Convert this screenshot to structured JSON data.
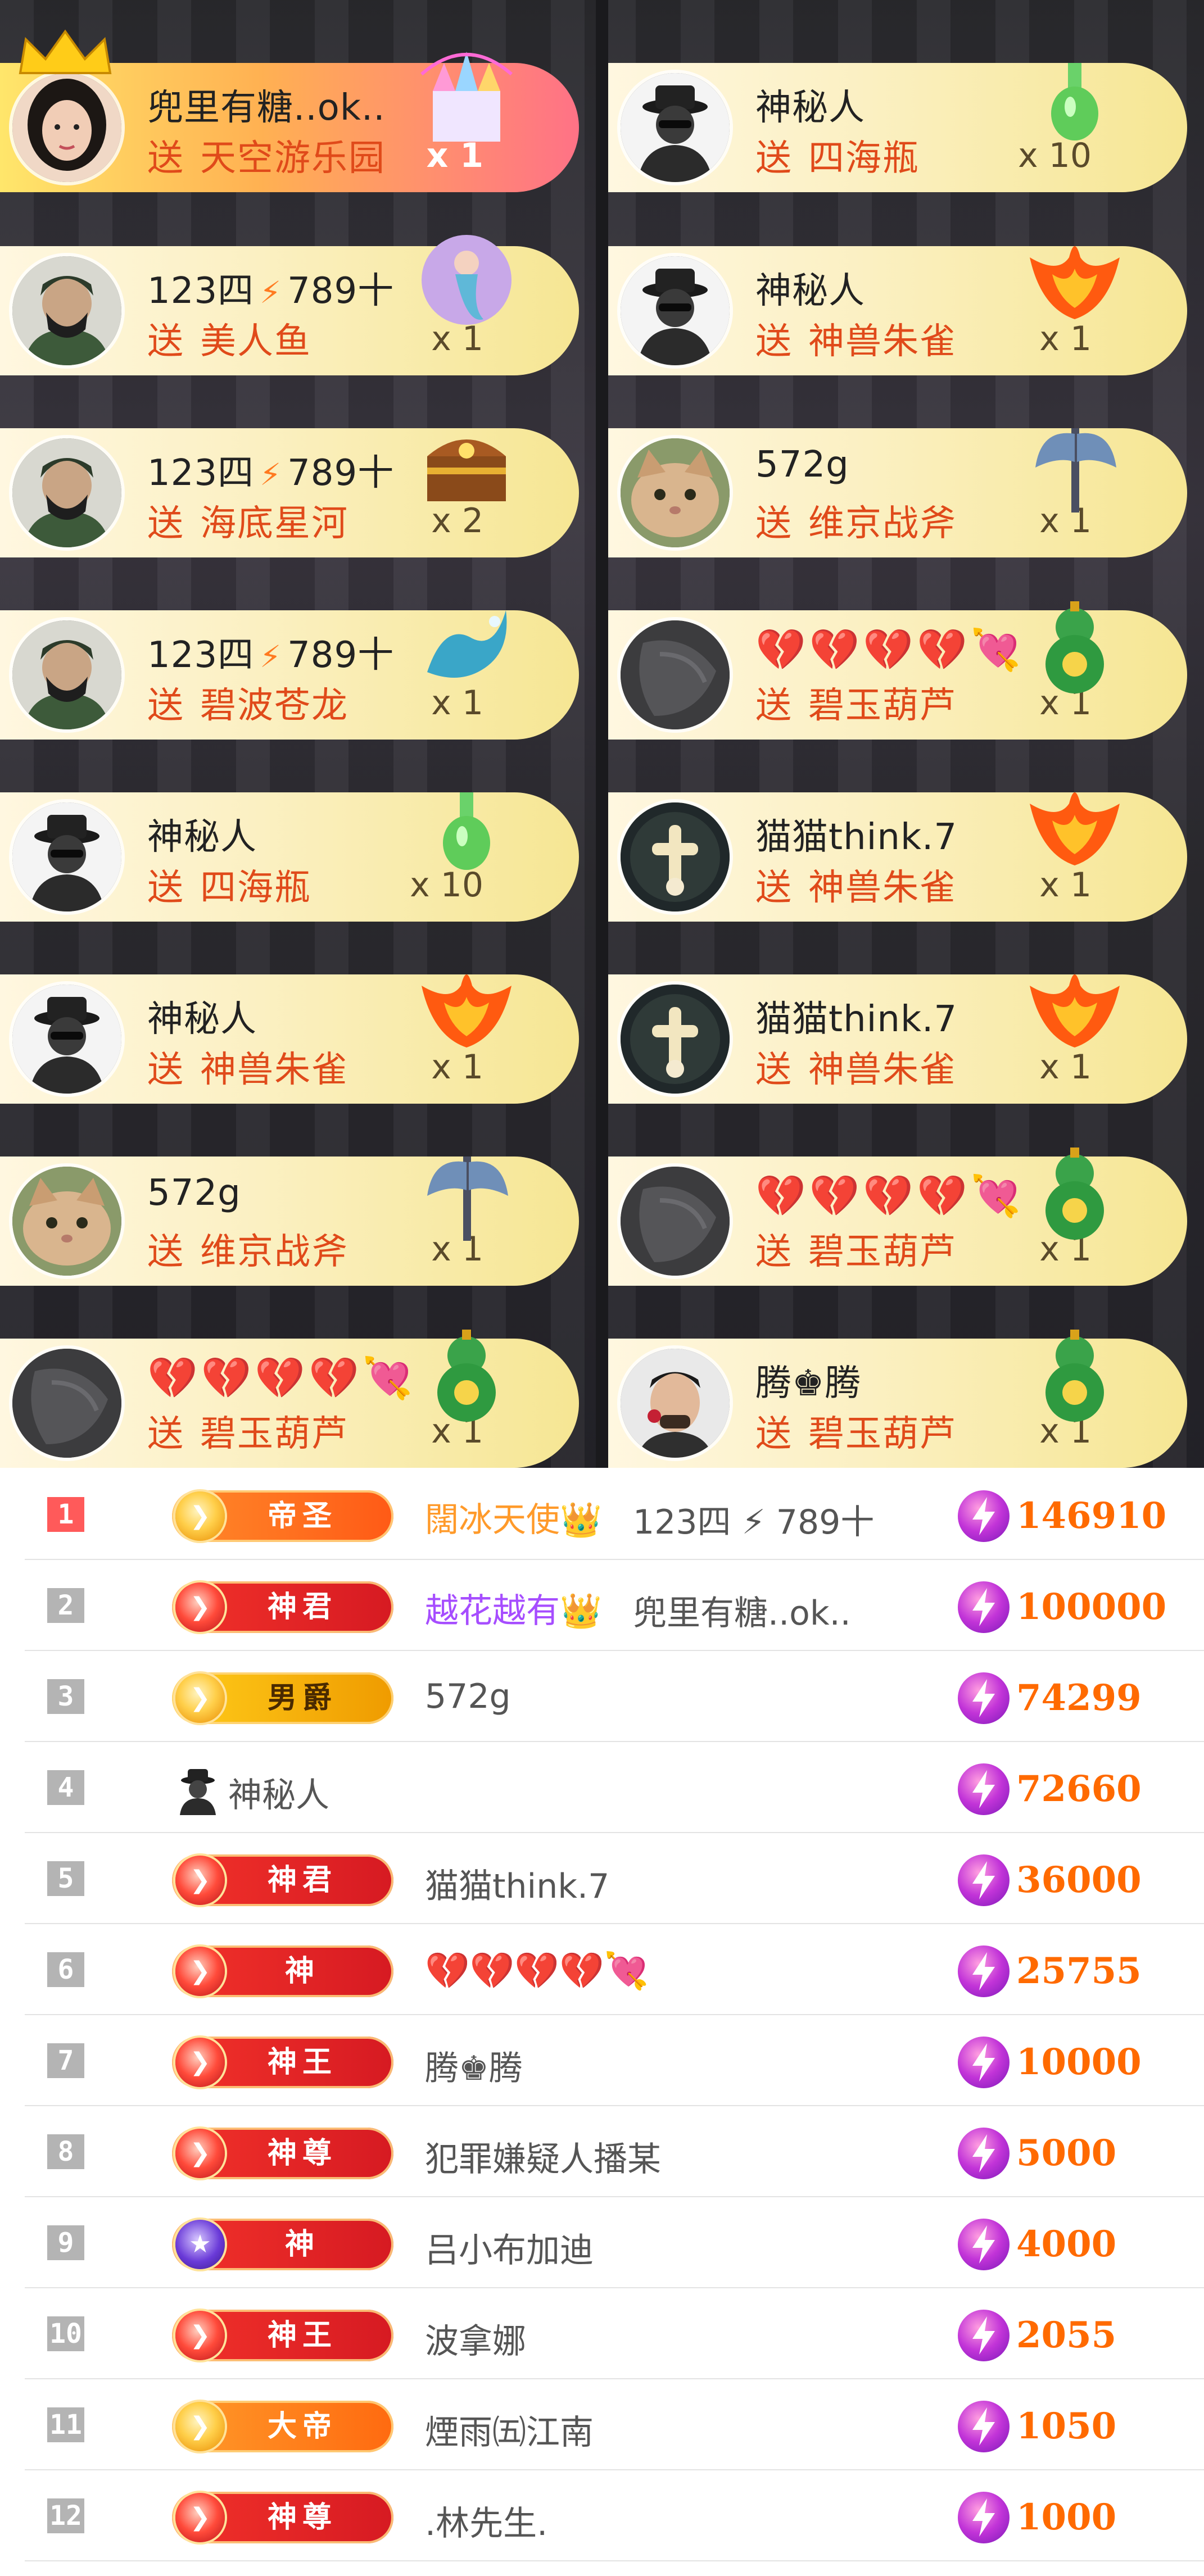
{
  "gift_feed": {
    "left": [
      {
        "user": "兜里有糖..ok..",
        "gift": "天空游乐园",
        "qty": "x 1",
        "send": "送",
        "avatar": "woman-avatar",
        "gift_icon": "castle-gift-icon",
        "vip": true
      },
      {
        "user": "123四",
        "user_suffix": "789十",
        "send": "送",
        "gift": "美人鱼",
        "qty": "x 1",
        "avatar": "warrior-avatar",
        "gift_icon": "mermaid-gift-icon"
      },
      {
        "user": "123四",
        "user_suffix": "789十",
        "send": "送",
        "gift": "海底星河",
        "qty": "x 2",
        "avatar": "warrior-avatar",
        "gift_icon": "treasure-chest-gift-icon"
      },
      {
        "user": "123四",
        "user_suffix": "789十",
        "send": "送",
        "gift": "碧波苍龙",
        "qty": "x 1",
        "avatar": "warrior-avatar",
        "gift_icon": "dragon-gift-icon"
      },
      {
        "user": "神秘人",
        "send": "送",
        "gift": "四海瓶",
        "qty": "x 10",
        "avatar": "mystery-avatar",
        "gift_icon": "bottle-gift-icon"
      },
      {
        "user": "神秘人",
        "send": "送",
        "gift": "神兽朱雀",
        "qty": "x 1",
        "avatar": "mystery-avatar",
        "gift_icon": "phoenix-gift-icon"
      },
      {
        "user": "572g",
        "send": "送",
        "gift": "维京战斧",
        "qty": "x 1",
        "avatar": "cat-avatar",
        "gift_icon": "axe-gift-icon"
      },
      {
        "user_hearts": "💔💔💔💔💘",
        "send": "送",
        "gift": "碧玉葫芦",
        "qty": "x 1",
        "avatar": "dark-avatar",
        "gift_icon": "gourd-gift-icon"
      }
    ],
    "right": [
      {
        "user": "神秘人",
        "send": "送",
        "gift": "四海瓶",
        "qty": "x 10",
        "avatar": "mystery-avatar",
        "gift_icon": "bottle-gift-icon"
      },
      {
        "user": "神秘人",
        "send": "送",
        "gift": "神兽朱雀",
        "qty": "x 1",
        "avatar": "mystery-avatar",
        "gift_icon": "phoenix-gift-icon"
      },
      {
        "user": "572g",
        "send": "送",
        "gift": "维京战斧",
        "qty": "x 1",
        "avatar": "cat-avatar",
        "gift_icon": "axe-gift-icon"
      },
      {
        "user_hearts": "💔💔💔💔💘",
        "send": "送",
        "gift": "碧玉葫芦",
        "qty": "x 1",
        "avatar": "dark-avatar",
        "gift_icon": "gourd-gift-icon"
      },
      {
        "user": "猫猫think.7",
        "send": "送",
        "gift": "神兽朱雀",
        "qty": "x 1",
        "avatar": "cross-avatar",
        "gift_icon": "phoenix-gift-icon"
      },
      {
        "user": "猫猫think.7",
        "send": "送",
        "gift": "神兽朱雀",
        "qty": "x 1",
        "avatar": "cross-avatar",
        "gift_icon": "phoenix-gift-icon"
      },
      {
        "user_hearts": "💔💔💔💔💘",
        "send": "送",
        "gift": "碧玉葫芦",
        "qty": "x 1",
        "avatar": "dark-avatar",
        "gift_icon": "gourd-gift-icon"
      },
      {
        "user": "腾♚腾",
        "send": "送",
        "gift": "碧玉葫芦",
        "qty": "x 1",
        "avatar": "man-rose-avatar",
        "gift_icon": "gourd-gift-icon"
      }
    ]
  },
  "ranking": [
    {
      "rank": "1",
      "badge": "帝圣",
      "medal_prefix": "闊冰天使👑",
      "name": "123四 ⚡ 789十",
      "score": "146910"
    },
    {
      "rank": "2",
      "badge": "神君",
      "medal_prefix": "越花越有👑",
      "name": "兜里有糖..ok..",
      "score": "100000"
    },
    {
      "rank": "3",
      "badge": "男爵",
      "name": "572g",
      "score": "74299"
    },
    {
      "rank": "4",
      "name": "神秘人",
      "score": "72660"
    },
    {
      "rank": "5",
      "badge": "神君",
      "name": "猫猫think.7",
      "score": "36000"
    },
    {
      "rank": "6",
      "badge": "神",
      "name": "💔💔💔💔💘",
      "score": "25755"
    },
    {
      "rank": "7",
      "badge": "神王",
      "name": "腾♚腾",
      "score": "10000"
    },
    {
      "rank": "8",
      "badge": "神尊",
      "name": "犯罪嫌疑人播某",
      "score": "5000"
    },
    {
      "rank": "9",
      "badge": "神",
      "name": "吕小布加迪",
      "score": "4000"
    },
    {
      "rank": "10",
      "badge": "神王",
      "name": "波拿娜",
      "score": "2055"
    },
    {
      "rank": "11",
      "badge": "大帝",
      "name": "煙雨㈤江南",
      "score": "1050"
    },
    {
      "rank": "12",
      "badge": "神尊",
      "name": ".林先生.",
      "score": "1000"
    }
  ],
  "colors": {
    "accent_orange": "#ff6a00",
    "feed_yellow": "#f6e693",
    "rank_first": "#ff5a5a",
    "purple_name": "#a64dff"
  }
}
